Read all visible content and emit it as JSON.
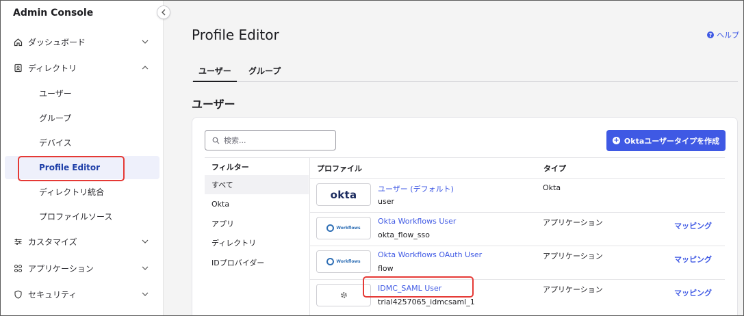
{
  "sidebar": {
    "brand": "Admin Console",
    "items": [
      {
        "label": "ダッシュボード",
        "icon": "home-icon",
        "chevron": "⌄"
      },
      {
        "label": "ディレクトリ",
        "icon": "directory-icon",
        "chevron": "⌃"
      },
      {
        "label": "カスタマイズ",
        "icon": "sliders-icon",
        "chevron": "⌄"
      },
      {
        "label": "アプリケーション",
        "icon": "apps-grid-icon",
        "chevron": "⌄"
      },
      {
        "label": "セキュリティ",
        "icon": "shield-icon",
        "chevron": "⌄"
      }
    ],
    "directory_subitems": [
      "ユーザー",
      "グループ",
      "デバイス",
      "Profile Editor",
      "ディレクトリ統合",
      "プロファイルソース"
    ]
  },
  "header": {
    "title": "Profile Editor",
    "help": "ヘルプ"
  },
  "tabs": [
    "ユーザー",
    "グループ"
  ],
  "section_title": "ユーザー",
  "search": {
    "placeholder": "検索..."
  },
  "create_button": "Oktaユーザータイプを作成",
  "filters": {
    "heading": "フィルター",
    "items": [
      "すべて",
      "Okta",
      "アプリ",
      "ディレクトリ",
      "IDプロバイダー"
    ]
  },
  "table": {
    "columns": [
      "プロファイル",
      "タイプ"
    ],
    "rows": [
      {
        "logo": "okta",
        "logo_text": "okta",
        "name": "ユーザー (デフォルト)",
        "id": "user",
        "type": "Okta",
        "action": ""
      },
      {
        "logo": "workflows",
        "logo_text": "Workflows",
        "name": "Okta Workflows User",
        "id": "okta_flow_sso",
        "type": "アプリケーション",
        "action": "マッピング"
      },
      {
        "logo": "workflows",
        "logo_text": "Workflows",
        "name": "Okta Workflows OAuth User",
        "id": "flow",
        "type": "アプリケーション",
        "action": "マッピング"
      },
      {
        "logo": "gear",
        "logo_text": "",
        "name": "IDMC_SAML User",
        "id": "trial4257065_idmcsaml_1",
        "type": "アプリケーション",
        "action": "マッピング"
      }
    ]
  },
  "colors": {
    "accent": "#3f59e4",
    "highlight": "#e53935"
  }
}
